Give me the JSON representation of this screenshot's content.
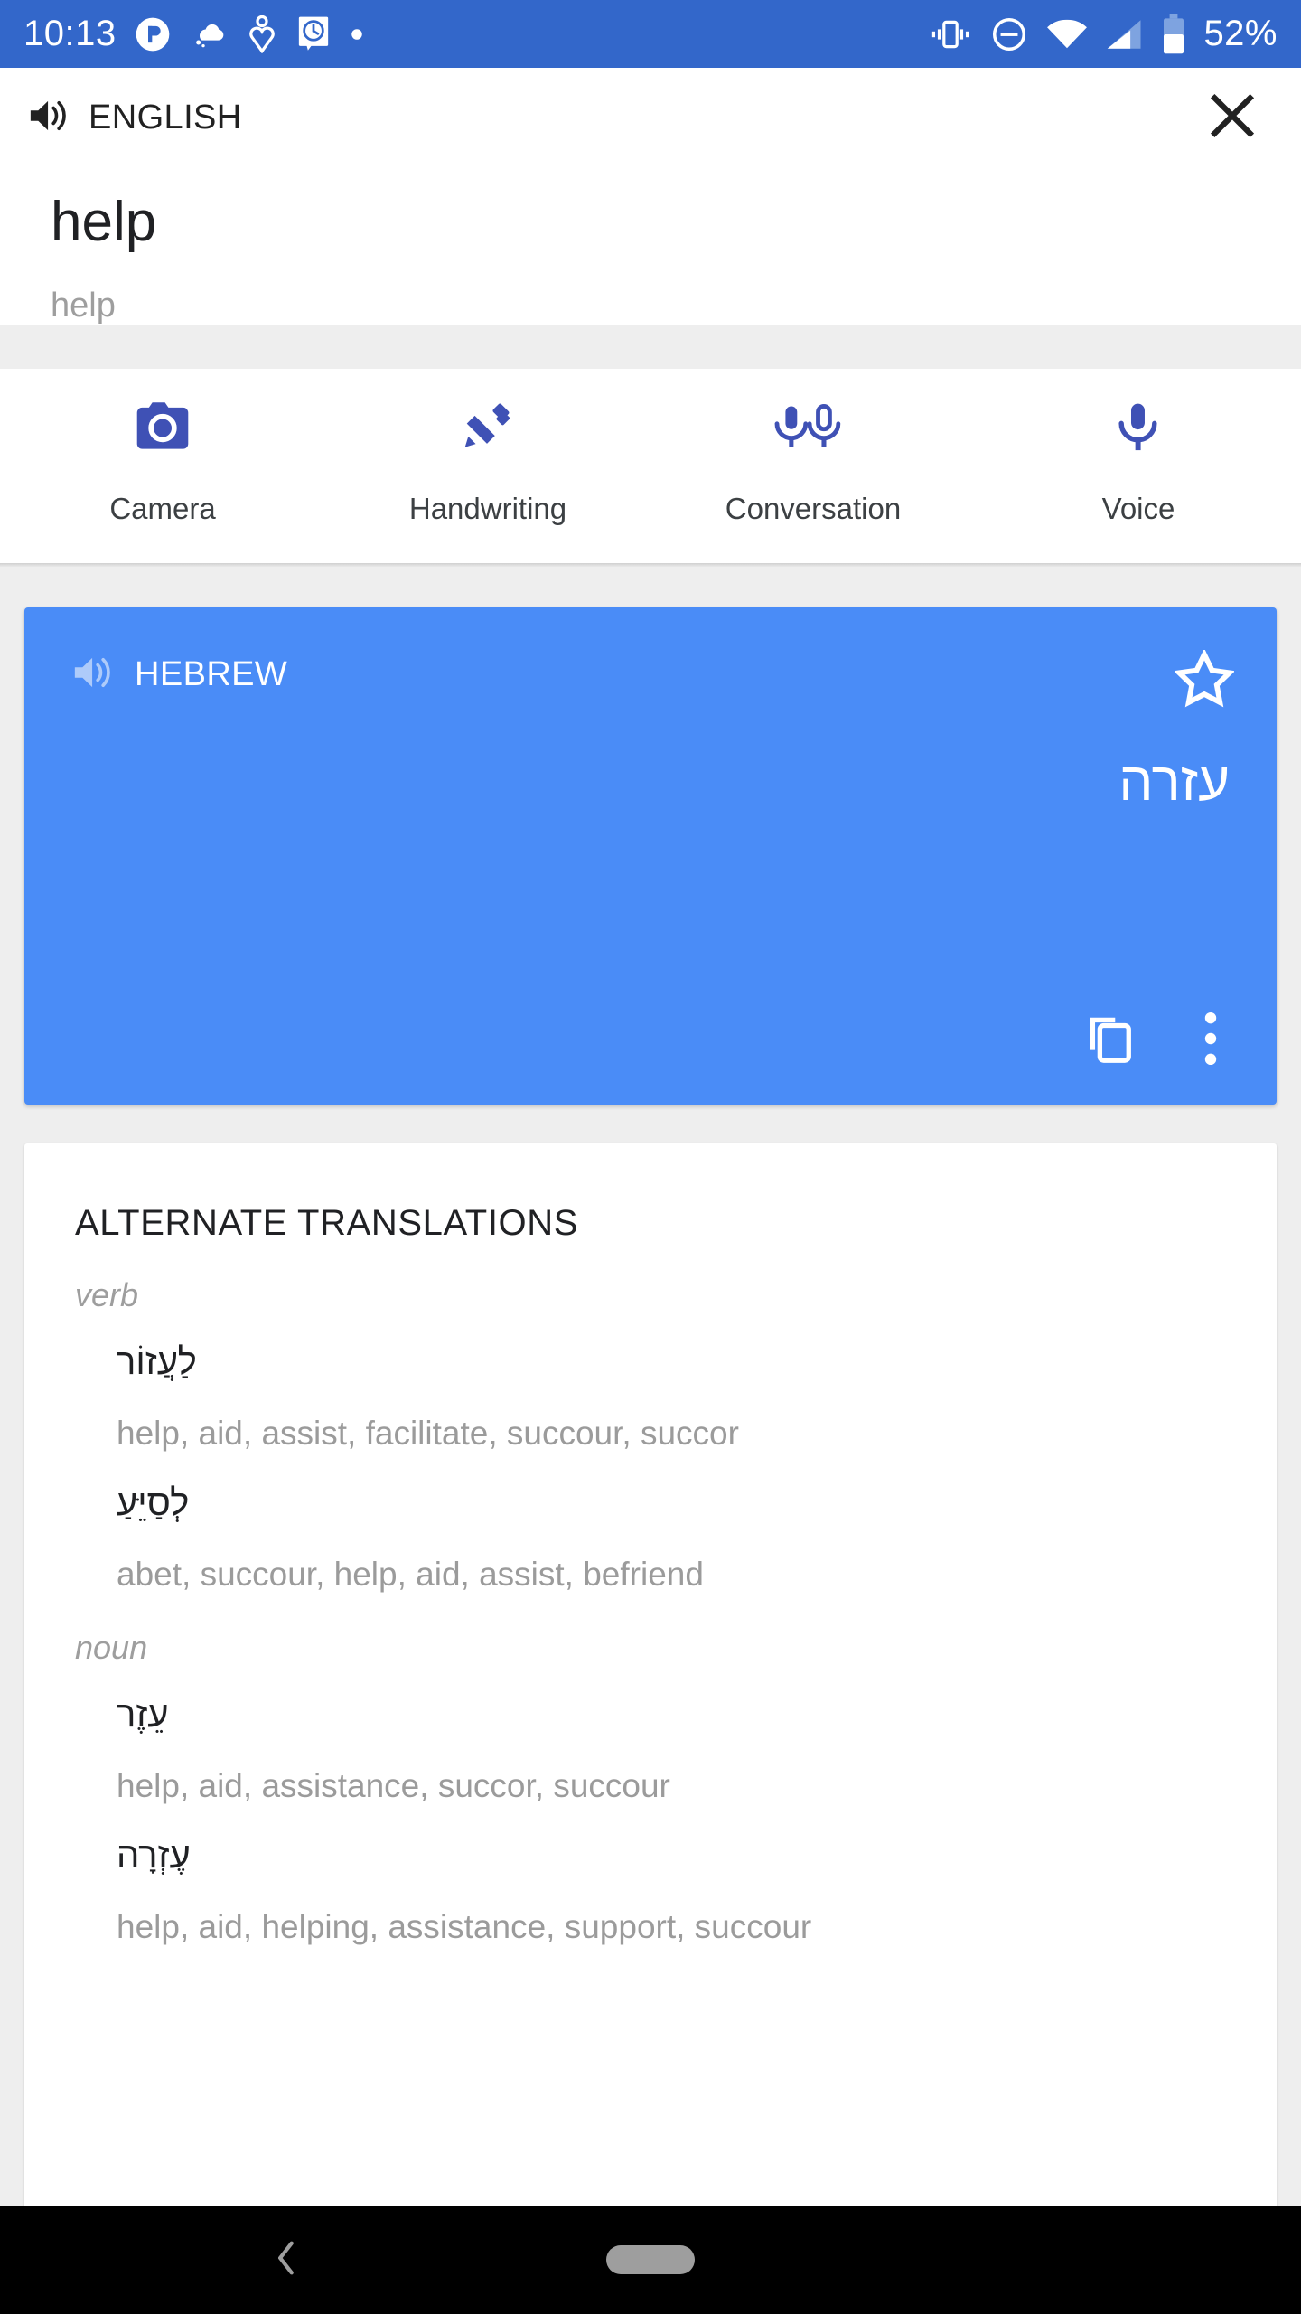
{
  "status_bar": {
    "time": "10:13",
    "battery_percent": "52%",
    "left_icons": [
      "pocketcasts-icon",
      "weather-cloud-icon",
      "health-heart-icon",
      "clock-message-icon",
      "dot-icon"
    ],
    "right_icons": [
      "vibrate-icon",
      "do-not-disturb-icon",
      "wifi-icon",
      "cell-signal-icon",
      "battery-icon"
    ],
    "background_color": "#3367ca"
  },
  "app_bar": {
    "source_language": "ENGLISH",
    "speaker_icon": "speaker-icon",
    "close_icon": "close-icon"
  },
  "source": {
    "word": "help",
    "transliteration": "help"
  },
  "input_methods": [
    {
      "label": "Camera",
      "icon": "camera-icon"
    },
    {
      "label": "Handwriting",
      "icon": "pen-icon"
    },
    {
      "label": "Conversation",
      "icon": "two-microphones-icon"
    },
    {
      "label": "Voice",
      "icon": "microphone-icon"
    }
  ],
  "translation_card": {
    "target_language": "HEBREW",
    "speaker_icon": "speaker-icon",
    "star_icon": "star-outline-icon",
    "translation": "עזרה",
    "copy_icon": "copy-icon",
    "overflow_icon": "more-vertical-icon",
    "background_color": "#4a8cf7"
  },
  "alternates": {
    "title": "ALTERNATE TRANSLATIONS",
    "groups": [
      {
        "part_of_speech": "verb",
        "entries": [
          {
            "word": "לַעֲזוֹר",
            "meanings": "help, aid, assist, facilitate, succour, succor"
          },
          {
            "word": "לְסַיֵּעַ",
            "meanings": "abet, succour, help, aid, assist, befriend"
          }
        ]
      },
      {
        "part_of_speech": "noun",
        "entries": [
          {
            "word": "עֵזֶר",
            "meanings": "help, aid, assistance, succor, succour"
          },
          {
            "word": "עֶזְרָה",
            "meanings": "help, aid, helping, assistance, support, succour"
          }
        ]
      }
    ]
  },
  "nav_bar": {
    "back_icon": "back-chevron-icon",
    "home_icon": "home-pill-icon",
    "background_color": "#000000"
  },
  "colors": {
    "accent_blue": "#4a8cf7",
    "status_blue": "#3367ca",
    "icon_indigo": "#3f51b5"
  }
}
